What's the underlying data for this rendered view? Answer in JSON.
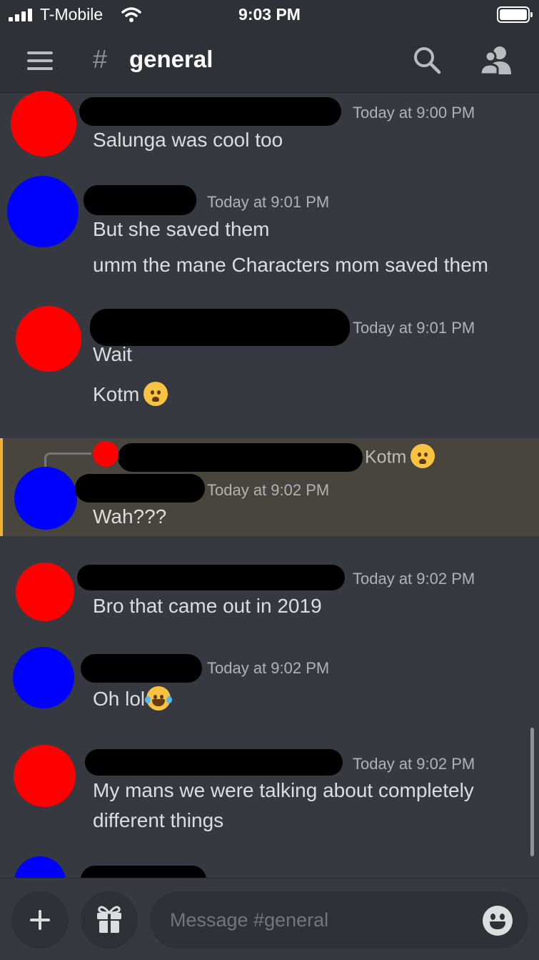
{
  "status_bar": {
    "carrier": "T-Mobile",
    "time": "9:03 PM"
  },
  "header": {
    "hash": "#",
    "channel": "general",
    "menu_icon": "hamburger-icon",
    "search_icon": "search-icon",
    "members_icon": "members-icon"
  },
  "messages": [
    {
      "timestamp": "Today at 9:00 PM",
      "avatar_color": "#ff0000",
      "lines": [
        "Salunga was cool too"
      ]
    },
    {
      "timestamp": "Today at 9:01 PM",
      "avatar_color": "#0000ff",
      "lines": [
        "But she saved them",
        "umm the mane Characters mom saved them"
      ]
    },
    {
      "timestamp": "Today at 9:01 PM",
      "avatar_color": "#ff0000",
      "lines": [
        "Wait",
        "Kotm"
      ]
    },
    {
      "timestamp": "Today at 9:02 PM",
      "avatar_color": "#0000ff",
      "reply_to": "Kotm",
      "lines": [
        "Wah???"
      ]
    },
    {
      "timestamp": "Today at 9:02 PM",
      "avatar_color": "#ff0000",
      "lines": [
        "Bro that came out in 2019"
      ]
    },
    {
      "timestamp": "Today at 9:02 PM",
      "avatar_color": "#0000ff",
      "lines": [
        "Oh lol"
      ]
    },
    {
      "timestamp": "Today at 9:02 PM",
      "avatar_color": "#ff0000",
      "lines": [
        "My mans we were talking about completely",
        "different things"
      ]
    },
    {
      "avatar_color": "#0000ff"
    }
  ],
  "composer": {
    "placeholder": "Message #general",
    "add_icon": "plus-icon",
    "gift_icon": "gift-icon",
    "emoji_icon": "emoji-icon"
  },
  "colors": {
    "background": "#36393f",
    "header": "#2f3136",
    "reply_highlight": "#47453e",
    "reply_accent": "#f0b132"
  }
}
